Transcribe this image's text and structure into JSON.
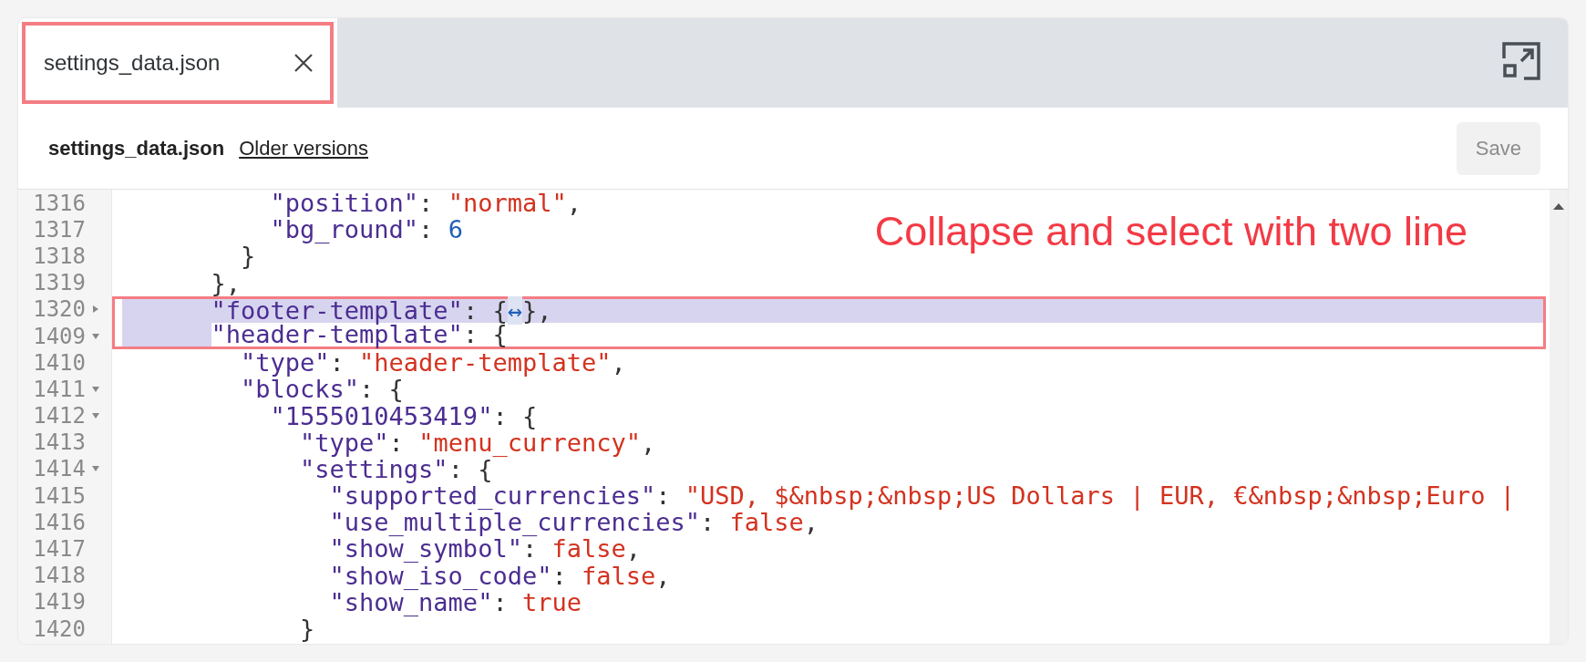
{
  "tab": {
    "label": "settings_data.json",
    "selected": true,
    "highlighted": true
  },
  "header": {
    "title": "settings_data.json",
    "link": "Older versions",
    "save_button": {
      "label": "Save",
      "disabled": true
    }
  },
  "annotation": "Collapse and select with two line",
  "lines": [
    {
      "number": "1316",
      "selected": false,
      "annotated": false,
      "tokens": [
        {
          "kind": "key",
          "text": "          \"position\""
        },
        {
          "kind": "punct",
          "text": ": "
        },
        {
          "kind": "string",
          "text": "\"normal\""
        },
        {
          "kind": "punct",
          "text": ","
        }
      ]
    },
    {
      "number": "1317",
      "selected": false,
      "annotated": false,
      "tokens": [
        {
          "kind": "key",
          "text": "          \"bg_round\""
        },
        {
          "kind": "punct",
          "text": ": "
        },
        {
          "kind": "number",
          "text": "6"
        }
      ]
    },
    {
      "number": "1318",
      "selected": false,
      "annotated": false,
      "tokens": [
        {
          "kind": "punct",
          "text": "        }"
        }
      ]
    },
    {
      "number": "1319",
      "selected": false,
      "annotated": false,
      "tokens": [
        {
          "kind": "punct",
          "text": "      },"
        }
      ]
    },
    {
      "number": "1320",
      "expanded": false,
      "selected": true,
      "annotated": true,
      "tokens": [
        {
          "kind": "key",
          "text": "      \"footer-template\""
        },
        {
          "kind": "punct",
          "text": ": {"
        },
        {
          "kind": "marker",
          "text": "↔"
        },
        {
          "kind": "punct",
          "text": "},"
        }
      ]
    },
    {
      "number": "1409",
      "expanded": true,
      "selected": true,
      "annotated": true,
      "tokens": [
        {
          "kind": "key",
          "text": "      \"header-template\""
        },
        {
          "kind": "punct",
          "text": ": {"
        }
      ]
    },
    {
      "number": "1410",
      "selected": false,
      "annotated": false,
      "tokens": [
        {
          "kind": "key",
          "text": "        \"type\""
        },
        {
          "kind": "punct",
          "text": ": "
        },
        {
          "kind": "string",
          "text": "\"header-template\""
        },
        {
          "kind": "punct",
          "text": ","
        }
      ]
    },
    {
      "number": "1411",
      "expanded": true,
      "selected": false,
      "annotated": false,
      "tokens": [
        {
          "kind": "key",
          "text": "        \"blocks\""
        },
        {
          "kind": "punct",
          "text": ": {"
        }
      ]
    },
    {
      "number": "1412",
      "expanded": true,
      "selected": false,
      "annotated": false,
      "tokens": [
        {
          "kind": "key",
          "text": "          \"1555010453419\""
        },
        {
          "kind": "punct",
          "text": ": {"
        }
      ]
    },
    {
      "number": "1413",
      "selected": false,
      "annotated": false,
      "tokens": [
        {
          "kind": "key",
          "text": "            \"type\""
        },
        {
          "kind": "punct",
          "text": ": "
        },
        {
          "kind": "string",
          "text": "\"menu_currency\""
        },
        {
          "kind": "punct",
          "text": ","
        }
      ]
    },
    {
      "number": "1414",
      "expanded": true,
      "selected": false,
      "annotated": false,
      "tokens": [
        {
          "kind": "key",
          "text": "            \"settings\""
        },
        {
          "kind": "punct",
          "text": ": {"
        }
      ]
    },
    {
      "number": "1415",
      "selected": false,
      "annotated": false,
      "tokens": [
        {
          "kind": "key",
          "text": "              \"supported_currencies\""
        },
        {
          "kind": "punct",
          "text": ": "
        },
        {
          "kind": "string",
          "text": "\"USD, $&nbsp;&nbsp;US Dollars | EUR, €&nbsp;&nbsp;Euro |"
        }
      ]
    },
    {
      "number": "1416",
      "selected": false,
      "annotated": false,
      "tokens": [
        {
          "kind": "key",
          "text": "              \"use_multiple_currencies\""
        },
        {
          "kind": "punct",
          "text": ": "
        },
        {
          "kind": "bool",
          "text": "false"
        },
        {
          "kind": "punct",
          "text": ","
        }
      ]
    },
    {
      "number": "1417",
      "selected": false,
      "annotated": false,
      "tokens": [
        {
          "kind": "key",
          "text": "              \"show_symbol\""
        },
        {
          "kind": "punct",
          "text": ": "
        },
        {
          "kind": "bool",
          "text": "false"
        },
        {
          "kind": "punct",
          "text": ","
        }
      ]
    },
    {
      "number": "1418",
      "selected": false,
      "annotated": false,
      "tokens": [
        {
          "kind": "key",
          "text": "              \"show_iso_code\""
        },
        {
          "kind": "punct",
          "text": ": "
        },
        {
          "kind": "bool",
          "text": "false"
        },
        {
          "kind": "punct",
          "text": ","
        }
      ]
    },
    {
      "number": "1419",
      "selected": false,
      "annotated": false,
      "tokens": [
        {
          "kind": "key",
          "text": "              \"show_name\""
        },
        {
          "kind": "punct",
          "text": ": "
        },
        {
          "kind": "bool",
          "text": "true"
        }
      ]
    },
    {
      "number": "1420",
      "selected": false,
      "annotated": false,
      "tokens": [
        {
          "kind": "punct",
          "text": "            }"
        }
      ]
    }
  ]
}
